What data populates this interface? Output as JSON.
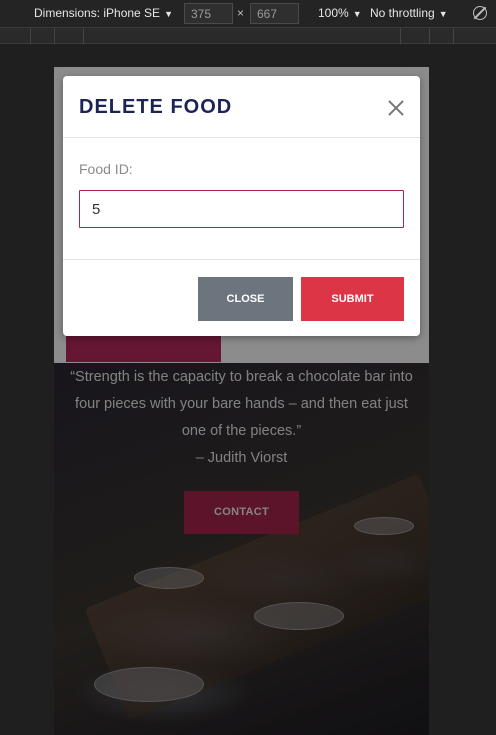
{
  "devtools": {
    "device_label": "Dimensions: iPhone SE",
    "width_value": "375",
    "height_value": "667",
    "times_symbol": "×",
    "zoom_label": "100%",
    "throttle_label": "No throttling",
    "caret": "▼"
  },
  "page": {
    "quote_lines": [
      "“Strength is the capacity to break a chocolate bar into",
      "four pieces with your bare hands – and then eat just",
      "one of the pieces.”",
      "– Judith Viorst"
    ],
    "contact_label": "CONTACT"
  },
  "modal": {
    "title": "DELETE FOOD",
    "field_label": "Food ID:",
    "field_value": "5",
    "close_label": "CLOSE",
    "submit_label": "SUBMIT"
  },
  "colors": {
    "accent": "#a8254f",
    "title": "#1b2454",
    "close_button": "#6c757d",
    "submit_button": "#dc3545"
  }
}
